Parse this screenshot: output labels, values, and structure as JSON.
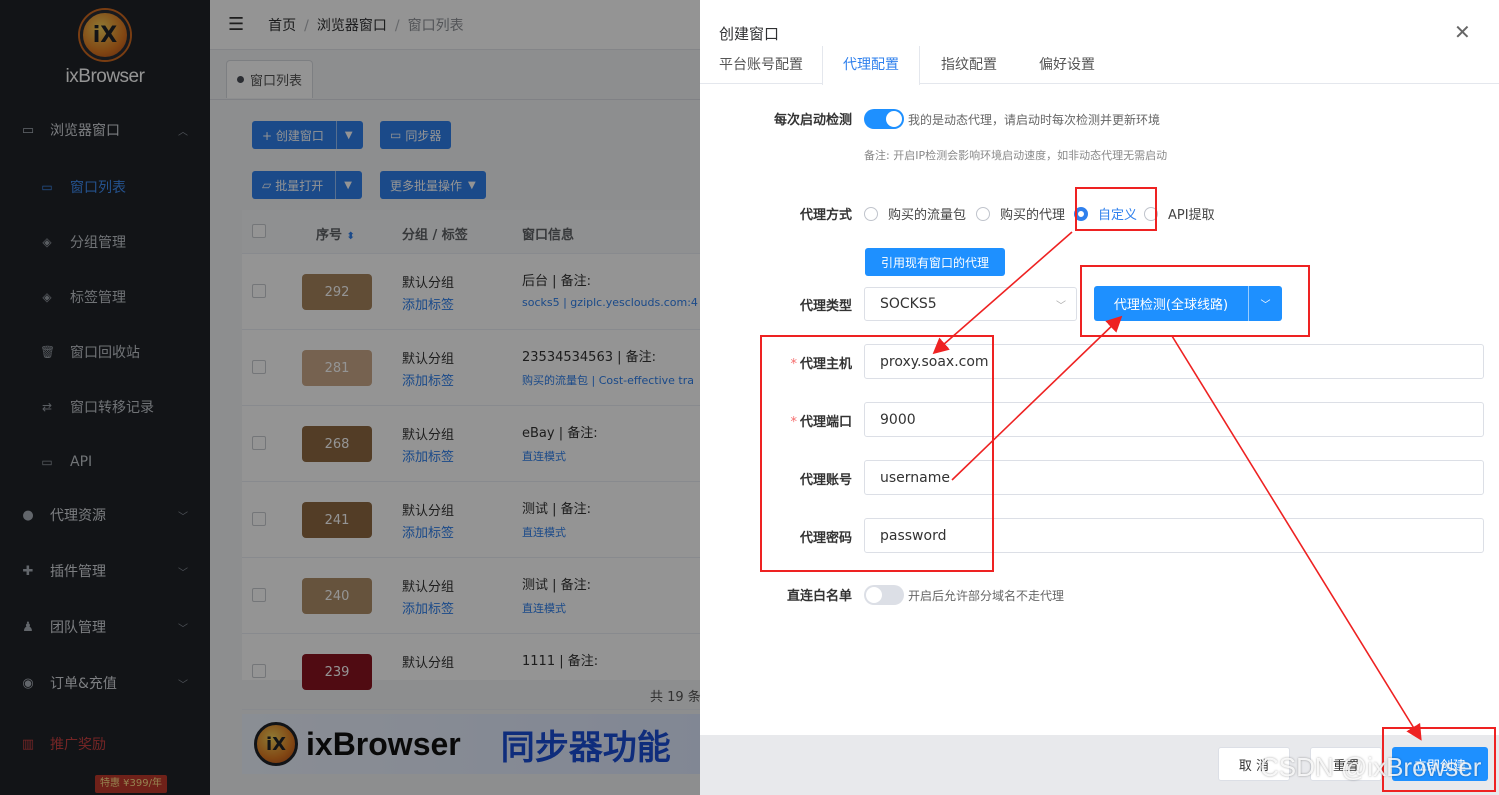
{
  "sidebar": {
    "logo_mark": "iX",
    "logo_text": "ixBrowser",
    "groups": [
      {
        "label": "浏览器窗口",
        "icon": "browser-window-icon"
      },
      {
        "label": "代理资源",
        "icon": "globe-icon"
      },
      {
        "label": "插件管理",
        "icon": "puzzle-icon"
      },
      {
        "label": "团队管理",
        "icon": "team-icon"
      },
      {
        "label": "订单&充值",
        "icon": "order-icon"
      },
      {
        "label": "推广奖励",
        "icon": "gift-icon"
      }
    ],
    "sub_items": [
      {
        "label": "窗口列表",
        "icon": "window-list-icon",
        "active": true
      },
      {
        "label": "分组管理",
        "icon": "layers-icon"
      },
      {
        "label": "标签管理",
        "icon": "layers-icon"
      },
      {
        "label": "窗口回收站",
        "icon": "trash-icon"
      },
      {
        "label": "窗口转移记录",
        "icon": "transfer-icon"
      },
      {
        "label": "API",
        "icon": "api-icon"
      }
    ],
    "promo_badge": "特惠 ¥399/年"
  },
  "header": {
    "breadcrumb": [
      "首页",
      "浏览器窗口",
      "窗口列表"
    ],
    "tab": "窗口列表"
  },
  "toolbar": {
    "create_window": "+ 创建窗口",
    "sync": "同步器",
    "batch_open": "批量打开",
    "more_batch": "更多批量操作"
  },
  "table": {
    "columns": [
      "序号",
      "分组 / 标签",
      "窗口信息"
    ],
    "rows": [
      {
        "id": "292",
        "group": "默认分组",
        "tag": "添加标签",
        "title": "后台 | 备注:",
        "proxy": "socks5 | gziplc.yesclouds.com:4",
        "color": "#a8855e"
      },
      {
        "id": "281",
        "group": "默认分组",
        "tag": "添加标签",
        "title": "23534534563 | 备注:",
        "proxy": "购买的流量包 | Cost-effective tra",
        "color": "#cba98a"
      },
      {
        "id": "268",
        "group": "默认分组",
        "tag": "添加标签",
        "title": "eBay | 备注:",
        "proxy": "直连模式",
        "color": "#8f6a43"
      },
      {
        "id": "241",
        "group": "默认分组",
        "tag": "添加标签",
        "title": "测试 | 备注:",
        "proxy": "直连模式",
        "color": "#8f6a43"
      },
      {
        "id": "240",
        "group": "默认分组",
        "tag": "添加标签",
        "title": "测试 | 备注:",
        "proxy": "直连模式",
        "color": "#b08f6a"
      },
      {
        "id": "239",
        "group": "默认分组",
        "tag": "",
        "title": "1111 | 备注:",
        "proxy": "",
        "color": "#8a1420"
      }
    ],
    "total": "共 19 条"
  },
  "banner": {
    "mark": "iX",
    "name": "ixBrowser",
    "slogan": "同步器功能"
  },
  "drawer": {
    "title": "创建窗口",
    "tabs": [
      "平台账号配置",
      "代理配置",
      "指纹配置",
      "偏好设置"
    ],
    "active_tab": 1,
    "check_each_launch": {
      "label": "每次启动检测",
      "on": true,
      "hint": "我的是动态代理，请启动时每次检测并更新环境",
      "note": "备注: 开启IP检测会影响环境启动速度，如非动态代理无需启动"
    },
    "proxy_method": {
      "label": "代理方式",
      "options": [
        "购买的流量包",
        "购买的代理",
        "自定义",
        "API提取"
      ],
      "selected": 2
    },
    "use_existing_btn": "引用现有窗口的代理",
    "proxy_type": {
      "label": "代理类型",
      "value": "SOCKS5"
    },
    "check_btn": "代理检测(全球线路)",
    "host": {
      "label": "代理主机",
      "value": "proxy.soax.com"
    },
    "port": {
      "label": "代理端口",
      "value": "9000"
    },
    "account": {
      "label": "代理账号",
      "value": "username"
    },
    "password": {
      "label": "代理密码",
      "value": "password"
    },
    "whitelist": {
      "label": "直连白名单",
      "on": false,
      "hint": "开启后允许部分域名不走代理"
    },
    "footer": {
      "cancel": "取 消",
      "reset": "重置",
      "create": "立即创建"
    }
  },
  "watermark": "CSDN @ixBrowser",
  "colors": {
    "primary": "#1e90ff",
    "sidebar_bg": "#1f2329",
    "annotation_red": "#ee2222"
  }
}
